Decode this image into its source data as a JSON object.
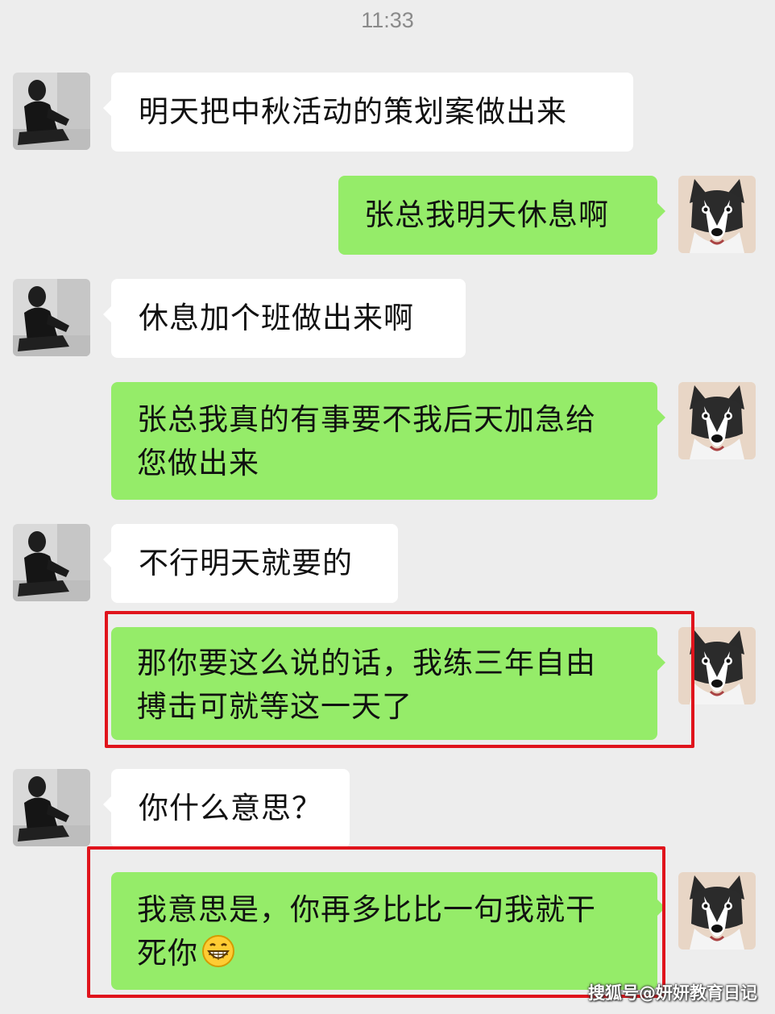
{
  "status": {
    "time": "11:33"
  },
  "colors": {
    "background": "#ededed",
    "bubble_self": "#95ec69",
    "bubble_other": "#ffffff",
    "highlight_border": "#e0141c"
  },
  "icons": {
    "boss_avatar": "person-photo-avatar",
    "my_avatar": "husky-dog-avatar",
    "emoji": "grinning-face-emoji"
  },
  "messages": [
    {
      "sender": "boss",
      "text": "明天把中秋活动的策划案做出来"
    },
    {
      "sender": "me",
      "text": "张总我明天休息啊"
    },
    {
      "sender": "boss",
      "text": "休息加个班做出来啊"
    },
    {
      "sender": "me",
      "line1": "张总我真的有事要不我后天加急给",
      "line2": "您做出来"
    },
    {
      "sender": "boss",
      "text": "不行明天就要的"
    },
    {
      "sender": "me",
      "line1": "那你要这么说的话，我练三年自由",
      "line2": "搏击可就等这一天了",
      "highlighted": true
    },
    {
      "sender": "boss",
      "text": "你什么意思？"
    },
    {
      "sender": "me",
      "line1": "我意思是，你再多比比一句我就干",
      "line2": "死你",
      "emoji": "grinning-face-emoji",
      "highlighted": true
    }
  ],
  "watermark": "搜狐号@妍妍教育日记"
}
